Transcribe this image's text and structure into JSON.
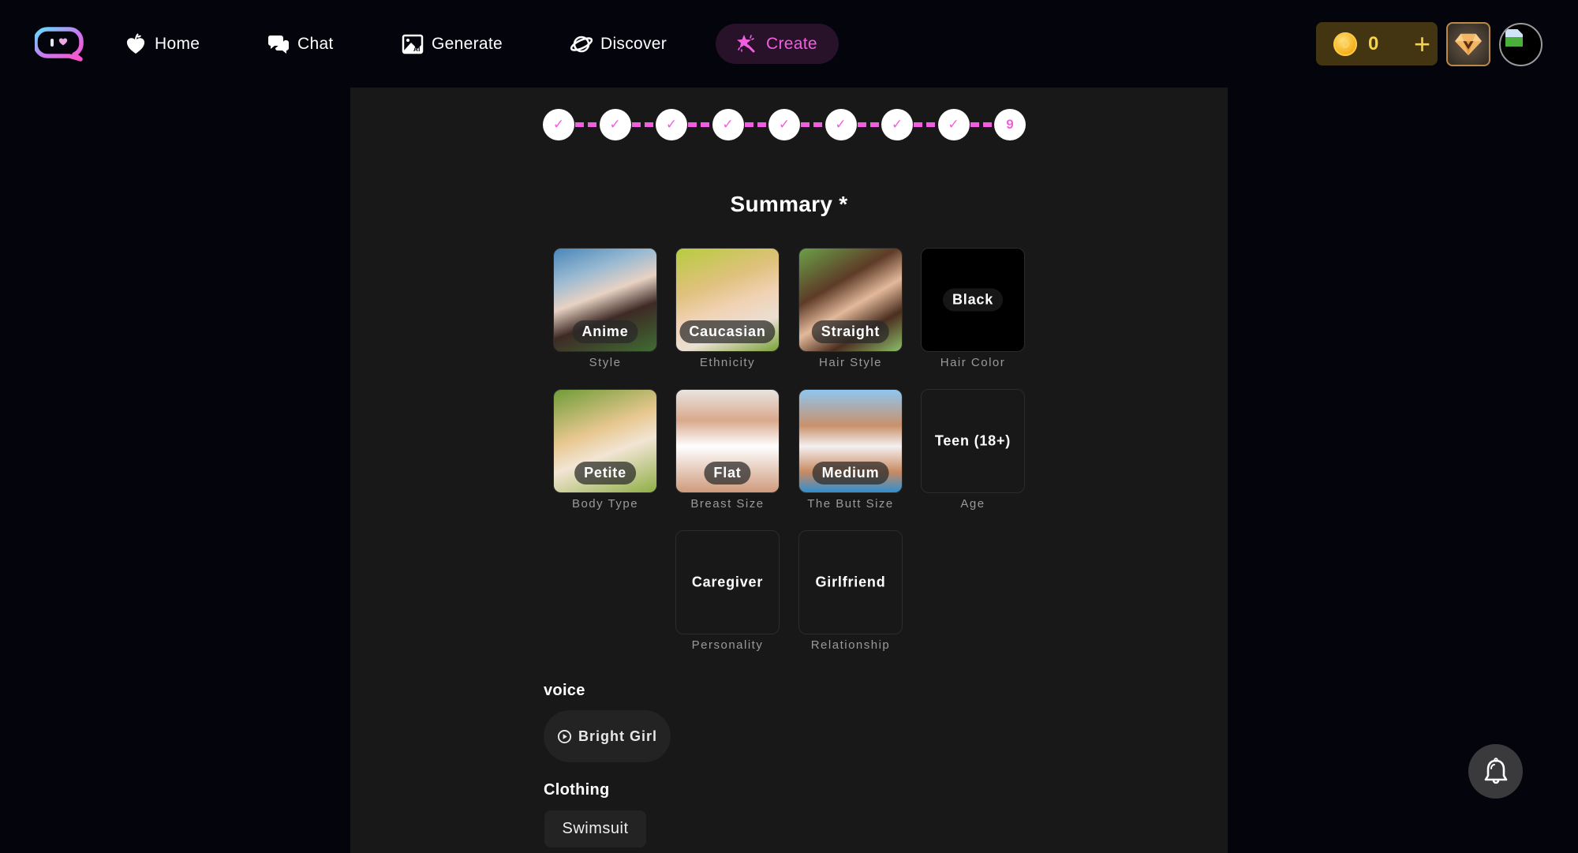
{
  "header": {
    "logo": "chat-heart-logo",
    "nav": [
      {
        "label": "Home",
        "icon": "heart-apple-icon"
      },
      {
        "label": "Chat",
        "icon": "chat-bubbles-icon"
      },
      {
        "label": "Generate",
        "icon": "ai-image-icon"
      },
      {
        "label": "Discover",
        "icon": "planet-icon"
      },
      {
        "label": "Create",
        "icon": "magic-wand-icon",
        "active": true
      }
    ],
    "coins": {
      "count": "0",
      "add_label": "+"
    },
    "vip_icon": "vip-diamond-icon",
    "avatar_icon": "broken-image-avatar"
  },
  "stepper": {
    "steps": [
      "✓",
      "✓",
      "✓",
      "✓",
      "✓",
      "✓",
      "✓",
      "✓",
      "9"
    ],
    "current": 9,
    "accent": "#f25ee0"
  },
  "summary": {
    "title": "Summary *",
    "cards": [
      {
        "value": "Anime",
        "label": "Style",
        "kind": "image"
      },
      {
        "value": "Caucasian",
        "label": "Ethnicity",
        "kind": "image"
      },
      {
        "value": "Straight",
        "label": "Hair Style",
        "kind": "image"
      },
      {
        "value": "Black",
        "label": "Hair Color",
        "kind": "color"
      },
      {
        "value": "Petite",
        "label": "Body Type",
        "kind": "image"
      },
      {
        "value": "Flat",
        "label": "Breast Size",
        "kind": "image"
      },
      {
        "value": "Medium",
        "label": "The Butt Size",
        "kind": "image"
      },
      {
        "value": "Teen (18+)",
        "label": "Age",
        "kind": "text"
      },
      {
        "value": "Caregiver",
        "label": "Personality",
        "kind": "text"
      },
      {
        "value": "Girlfriend",
        "label": "Relationship",
        "kind": "text"
      }
    ],
    "voice": {
      "label": "voice",
      "value": "Bright Girl",
      "icon": "play-circle-icon"
    },
    "clothing": {
      "label": "Clothing",
      "value": "Swimsuit"
    }
  },
  "notification": {
    "icon": "bell-icon"
  }
}
